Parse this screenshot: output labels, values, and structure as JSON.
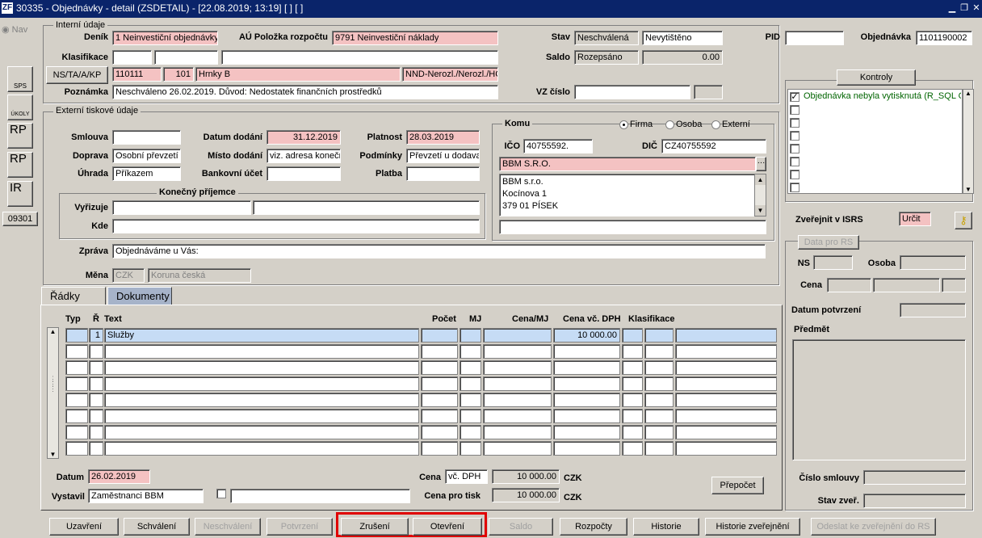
{
  "window": {
    "title": "30335 - Objednávky - detail (ZSDETAIL) - [22.08.2019; 13:19]  [ ]  [ ]",
    "logo": "ZF"
  },
  "nav": {
    "label": "Nav",
    "buttons": [
      "SPS",
      "ÚKOLY",
      "RP",
      "RP",
      "IR"
    ],
    "code": "09301"
  },
  "internal": {
    "title": "Interní údaje",
    "denik_label": "Deník",
    "denik": "1 Neinvestiční objednávky",
    "au_label": "AÚ Položka rozpočtu",
    "au": "9791 Neinvestiční náklady",
    "stav_label": "Stav",
    "stav1": "Neschválená",
    "stav2": "Nevytištěno",
    "pid_label": "PID",
    "pid": "",
    "obj_label": "Objednávka",
    "obj": "1101190002",
    "klas_label": "Klasifikace",
    "saldo_label": "Saldo",
    "saldo1": "Rozepsáno",
    "saldo2": "0.00",
    "ns_button": "NS/TA/A/KP",
    "ns1": "110111",
    "ns2": "101",
    "ns3": "Hrnky B",
    "ns4": "NND-Nerozl./Nerozl./HČ-",
    "pozn_label": "Poznámka",
    "pozn": "Neschváleno 26.02.2019. Důvod: Nedostatek finančních prostředků",
    "vz_label": "VZ číslo"
  },
  "external": {
    "title": "Externí tiskové údaje",
    "smlouva_label": "Smlouva",
    "smlouva": "",
    "doprava_label": "Doprava",
    "doprava": "Osobní převzetí",
    "uhrada_label": "Úhrada",
    "uhrada": "Příkazem",
    "datum_dod_label": "Datum dodání",
    "datum_dod": "31.12.2019",
    "misto_label": "Místo dodání",
    "misto": "viz. adresa konečn",
    "bank_label": "Bankovní účet",
    "bank": "",
    "platnost_label": "Platnost",
    "platnost": "28.03.2019",
    "podminky_label": "Podmínky",
    "podminky": "Převzetí u dodava",
    "platba_label": "Platba",
    "platba": "",
    "konecny_title": "Konečný příjemce",
    "vyrizuje_label": "Vyřizuje",
    "kde_label": "Kde",
    "zprava_label": "Zpráva",
    "zprava": "Objednáváme u Vás:",
    "mena_label": "Měna",
    "mena1": "CZK",
    "mena2": "Koruna česká"
  },
  "komu": {
    "title": "Komu",
    "radios": [
      "Firma",
      "Osoba",
      "Externí"
    ],
    "ico_label": "IČO",
    "ico": "40755592.",
    "dic_label": "DIČ",
    "dic": "CZ40755592",
    "firma": "BBM S.R.O.",
    "addr": [
      "BBM s.r.o.",
      "Kocínova 1",
      "379 01  PÍSEK"
    ]
  },
  "kontroly": {
    "button": "Kontroly",
    "items": [
      "Objednávka nebyla vytisknutá (R_SQL O"
    ]
  },
  "isrs": {
    "label": "Zveřejnit v ISRS",
    "value": "Určit",
    "group": "Data pro RS",
    "ns_label": "NS",
    "osoba_label": "Osoba",
    "cena_label": "Cena",
    "datum_label": "Datum potvrzení",
    "predmet_label": "Předmět",
    "cislo_label": "Číslo smlouvy",
    "stav_label": "Stav zveř."
  },
  "tabs": [
    "Řádky",
    "Dokumenty"
  ],
  "grid": {
    "headers": [
      "Typ",
      "Ř",
      "Text",
      "Počet",
      "MJ",
      "Cena/MJ",
      "Cena vč. DPH",
      "Klasifikace"
    ],
    "rows": [
      {
        "r": "1",
        "text": "Služby",
        "cena": "10 000.00"
      }
    ]
  },
  "footer": {
    "datum_label": "Datum",
    "datum": "26.02.2019",
    "vystavil_label": "Vystavil",
    "vystavil": "Zaměstnanci BBM",
    "cena_label": "Cena",
    "cena_typ": "vč. DPH",
    "cena": "10 000.00",
    "cur": "CZK",
    "cena_tisk_label": "Cena pro tisk",
    "cena_tisk": "10 000.00",
    "prepocet": "Přepočet"
  },
  "buttons": [
    "Uzavření",
    "Schválení",
    "Neschválení",
    "Potvrzení",
    "Zrušení",
    "Otevření",
    "Saldo",
    "Rozpočty",
    "Historie",
    "Historie zveřejnění",
    "Odeslat ke zveřejnění do RS"
  ],
  "colors": {
    "title": "#0a246a",
    "pink": "#f4c2c2",
    "highlight": "#e00000",
    "selected_row": "#c6dcf5"
  }
}
